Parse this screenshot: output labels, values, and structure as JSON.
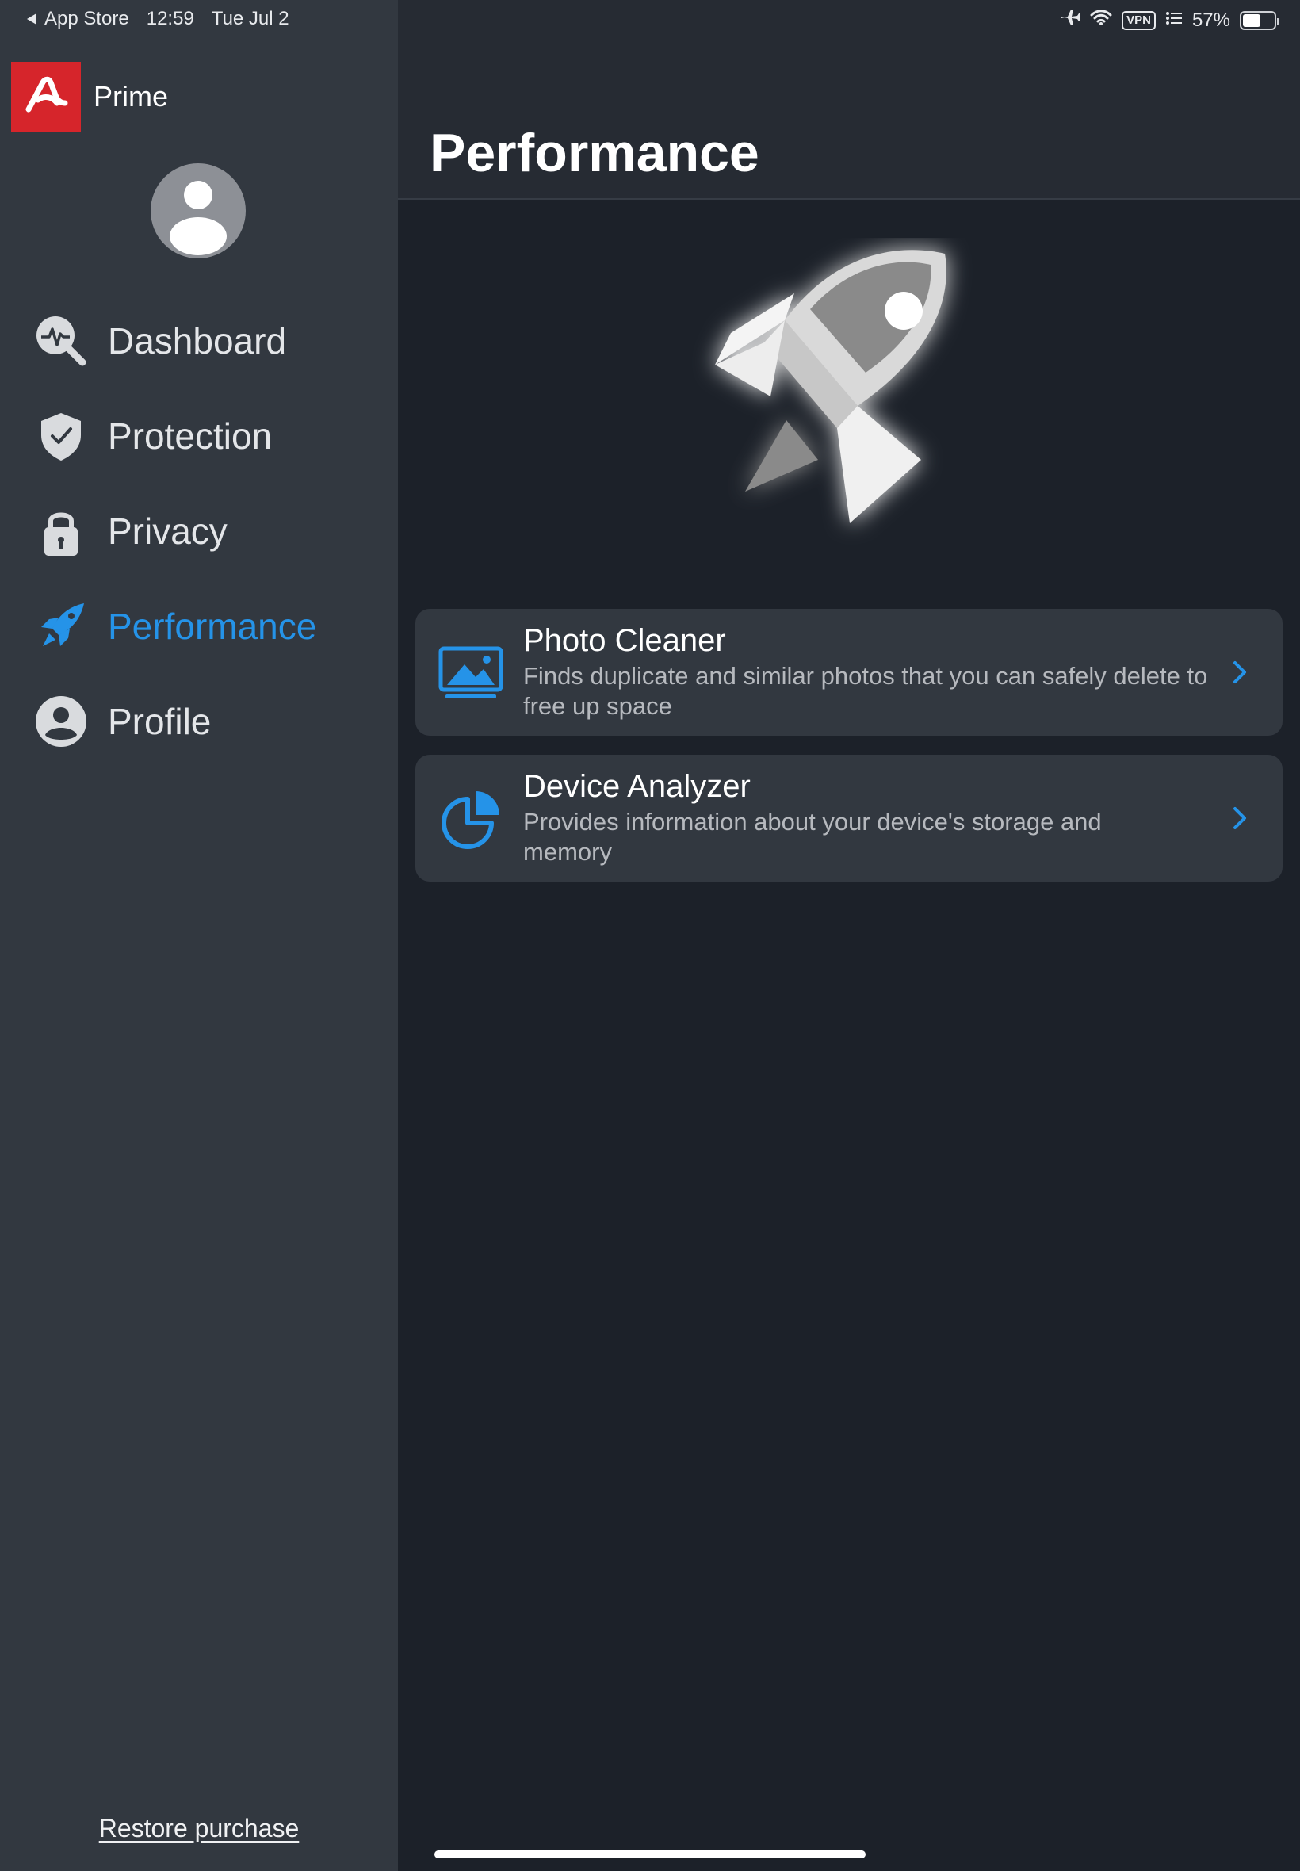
{
  "status_bar": {
    "back_label": "App Store",
    "time": "12:59",
    "date": "Tue Jul 2",
    "vpn": "VPN",
    "battery": "57%",
    "battery_level": 0.57
  },
  "sidebar": {
    "brand_name": "Prime",
    "nav": [
      {
        "label": "Dashboard",
        "icon": "dashboard-icon"
      },
      {
        "label": "Protection",
        "icon": "shield-check-icon"
      },
      {
        "label": "Privacy",
        "icon": "lock-icon"
      },
      {
        "label": "Performance",
        "icon": "rocket-icon",
        "active": true
      },
      {
        "label": "Profile",
        "icon": "profile-icon"
      }
    ],
    "restore_label": "Restore purchase"
  },
  "main": {
    "title": "Performance",
    "cards": [
      {
        "title": "Photo Cleaner",
        "description": "Finds duplicate and similar photos that you can safely delete to free up space",
        "icon": "photo-icon"
      },
      {
        "title": "Device Analyzer",
        "description": "Provides information about your device's storage and memory",
        "icon": "pie-chart-icon"
      }
    ]
  },
  "colors": {
    "accent": "#2593e8",
    "brand_red": "#d6252b",
    "sidebar_bg": "#323840",
    "main_bg": "#1c2129",
    "card_bg": "#323840"
  }
}
